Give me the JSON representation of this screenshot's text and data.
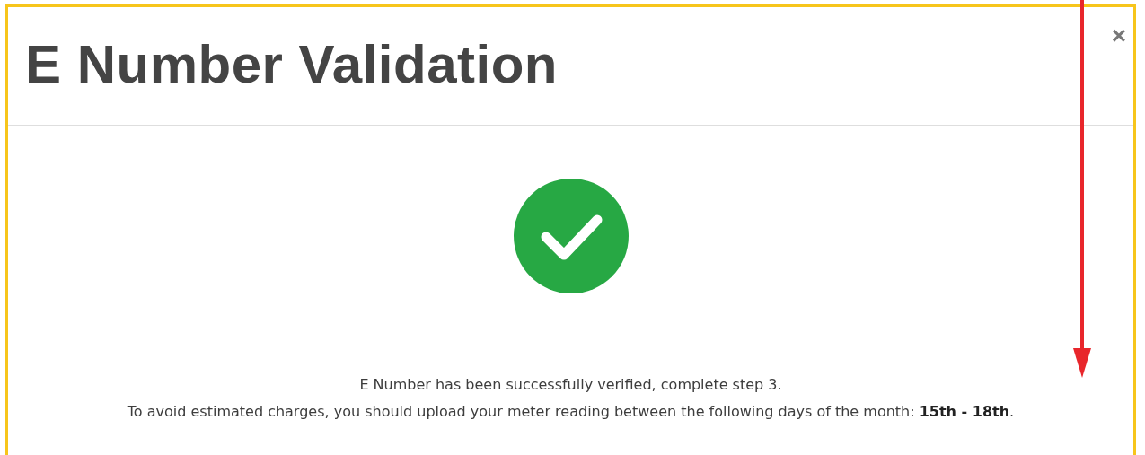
{
  "dialog": {
    "title": "E Number Validation",
    "close": "×",
    "success": true,
    "message_lines": [
      "E Number has been successfully verified, complete step 3.",
      "To avoid estimated charges, you should upload your meter reading between the following days of the month: **15th - 18th**."
    ]
  }
}
